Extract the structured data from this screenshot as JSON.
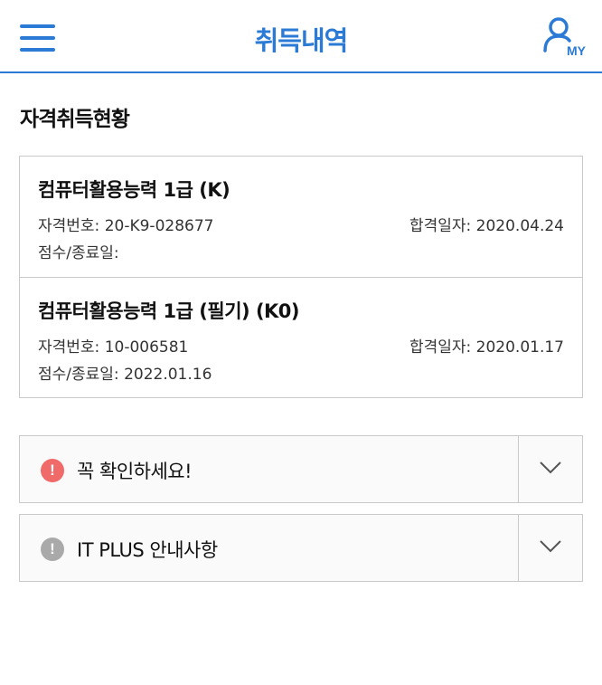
{
  "header": {
    "title": "취득내역",
    "my_label": "MY"
  },
  "section": {
    "title": "자격취득현황"
  },
  "certificates": [
    {
      "name": "컴퓨터활용능력 1급 (K)",
      "number_label": "자격번호:",
      "number": "20-K9-028677",
      "pass_date_label": "합격일자:",
      "pass_date": "2020.04.24",
      "score_label": "점수/종료일:",
      "score": ""
    },
    {
      "name": "컴퓨터활용능력 1급 (필기) (K0)",
      "number_label": "자격번호:",
      "number": "10-006581",
      "pass_date_label": "합격일자:",
      "pass_date": "2020.01.17",
      "score_label": "점수/종료일:",
      "score": "2022.01.16"
    }
  ],
  "notices": [
    {
      "label": "꼭 확인하세요!",
      "icon": "exclamation-icon",
      "color": "#f06a6a"
    },
    {
      "label": "IT PLUS 안내사항",
      "icon": "exclamation-icon",
      "color": "#a9a9a9"
    }
  ],
  "colors": {
    "accent": "#2b7bd6",
    "border": "#c9c9c9"
  }
}
